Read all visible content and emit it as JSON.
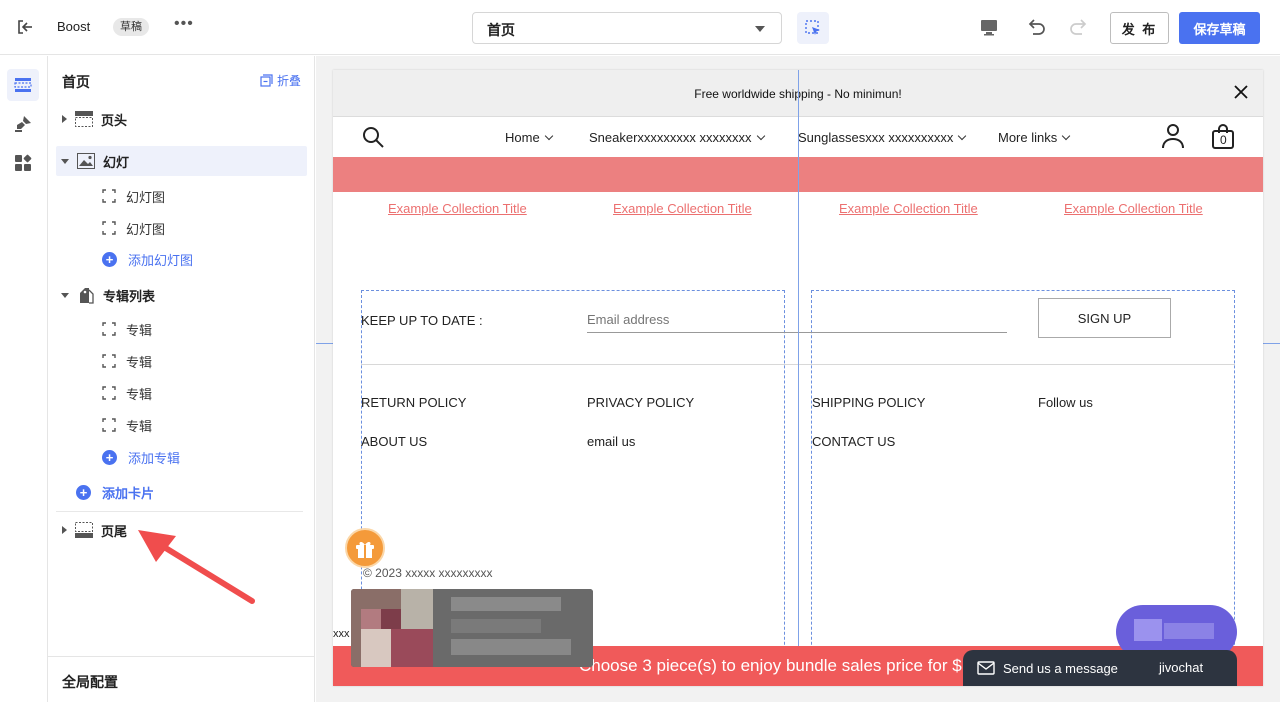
{
  "topbar": {
    "app_name": "Boost",
    "status_badge": "草稿",
    "more": "•••",
    "page_select_value": "首页",
    "publish_label": "发 布",
    "save_label": "保存草稿"
  },
  "panel": {
    "title": "首页",
    "collapse_label": "折叠",
    "sections": {
      "header": "页头",
      "slideshow": "幻灯",
      "slides": [
        "幻灯图",
        "幻灯图"
      ],
      "add_slide": "添加幻灯图",
      "collection_list": "专辑列表",
      "collections": [
        "专辑",
        "专辑",
        "专辑",
        "专辑"
      ],
      "add_collection": "添加专辑",
      "add_card": "添加卡片",
      "footer": "页尾"
    },
    "global_config": "全局配置"
  },
  "preview": {
    "announcement": "Free worldwide shipping - No minimun!",
    "nav": [
      {
        "label": "Home"
      },
      {
        "label": "Sneakerxxxxxxxxx xxxxxxxx"
      },
      {
        "label": "Sunglassesxxx xxxxxxxxxx"
      },
      {
        "label": "More links"
      }
    ],
    "cart_count": "0",
    "collection_links": [
      "Example Collection Title",
      "Example Collection Title",
      "Example Collection Title",
      "Example Collection Title"
    ],
    "newsletter": {
      "label": "KEEP UP TO DATE :",
      "placeholder": "Email address",
      "button": "SIGN UP"
    },
    "footer_links": {
      "col1": [
        "RETURN POLICY",
        "ABOUT US"
      ],
      "col2": [
        "PRIVACY POLICY",
        "email us"
      ],
      "col3": [
        "SHIPPING POLICY",
        "CONTACT US"
      ],
      "col4": [
        "Follow us"
      ]
    },
    "copyright": "© 2023 xxxxx xxxxxxxxx",
    "xxx_text": "xxx",
    "bundle_text": "Choose 3 piece(s) to enjoy bundle sales price for $",
    "chat": {
      "message": "Send us a message",
      "brand": "jivochat"
    }
  },
  "colors": {
    "accent": "#4a72f0",
    "promo_bar": "#ec8080",
    "bundle_bar": "#f05a5a",
    "arrow": "#f04d4d"
  }
}
